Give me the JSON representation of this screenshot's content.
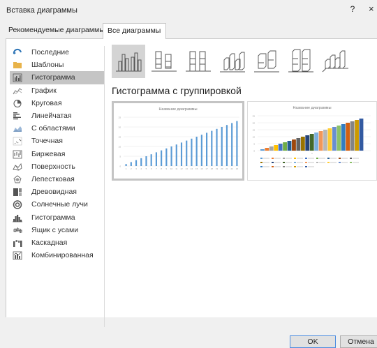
{
  "window": {
    "title": "Вставка диаграммы",
    "help": "?",
    "close": "×"
  },
  "tabs": [
    {
      "label": "Рекомендуемые диаграммы"
    },
    {
      "label": "Все диаграммы"
    }
  ],
  "sidebar": {
    "items": [
      {
        "label": "Последние",
        "icon": "recent-icon"
      },
      {
        "label": "Шаблоны",
        "icon": "folder-icon"
      },
      {
        "label": "Гистограмма",
        "icon": "column-chart-icon",
        "selected": true
      },
      {
        "label": "График",
        "icon": "line-chart-icon"
      },
      {
        "label": "Круговая",
        "icon": "pie-chart-icon"
      },
      {
        "label": "Линейчатая",
        "icon": "bar-chart-icon"
      },
      {
        "label": "С областями",
        "icon": "area-chart-icon"
      },
      {
        "label": "Точечная",
        "icon": "scatter-chart-icon"
      },
      {
        "label": "Биржевая",
        "icon": "stock-chart-icon"
      },
      {
        "label": "Поверхность",
        "icon": "surface-chart-icon"
      },
      {
        "label": "Лепестковая",
        "icon": "radar-chart-icon"
      },
      {
        "label": "Древовидная",
        "icon": "treemap-chart-icon"
      },
      {
        "label": "Солнечные лучи",
        "icon": "sunburst-chart-icon"
      },
      {
        "label": "Гистограмма",
        "icon": "histogram-chart-icon"
      },
      {
        "label": "Ящик с усами",
        "icon": "box-whisker-chart-icon"
      },
      {
        "label": "Каскадная",
        "icon": "waterfall-chart-icon"
      },
      {
        "label": "Комбинированная",
        "icon": "combo-chart-icon"
      }
    ]
  },
  "subtypes": [
    {
      "name": "clustered-column-subtype"
    },
    {
      "name": "stacked-column-subtype"
    },
    {
      "name": "100-stacked-column-subtype"
    },
    {
      "name": "3d-clustered-column-subtype"
    },
    {
      "name": "3d-stacked-column-subtype"
    },
    {
      "name": "3d-100-stacked-column-subtype"
    },
    {
      "name": "3d-column-subtype"
    }
  ],
  "section_title": "Гистограмма с группировкой",
  "previews": [
    {
      "title": "Название диаграммы",
      "chart_data": {
        "type": "bar",
        "categories": [
          "1",
          "2",
          "3",
          "4",
          "5",
          "6",
          "7",
          "8",
          "9",
          "10",
          "11",
          "12",
          "13",
          "14",
          "15",
          "16",
          "17",
          "18",
          "19",
          "20",
          "21",
          "22",
          "23"
        ],
        "values": [
          1,
          2,
          3,
          4,
          5,
          6,
          7,
          8,
          9,
          10,
          11,
          12,
          13,
          14,
          15,
          16,
          17,
          18,
          19,
          20,
          21,
          22,
          23
        ],
        "title": "Название диаграммы",
        "ylim": [
          0,
          25
        ],
        "grid": true,
        "color": "#5b9bd5"
      }
    },
    {
      "title": "Название диаграммы",
      "chart_data": {
        "type": "bar",
        "categories": [
          "1"
        ],
        "series": [
          {
            "values": [
              1
            ]
          },
          {
            "values": [
              2
            ]
          },
          {
            "values": [
              3
            ]
          },
          {
            "values": [
              4
            ]
          },
          {
            "values": [
              5
            ]
          },
          {
            "values": [
              6
            ]
          },
          {
            "values": [
              7
            ]
          },
          {
            "values": [
              8
            ]
          },
          {
            "values": [
              9
            ]
          },
          {
            "values": [
              10
            ]
          },
          {
            "values": [
              11
            ]
          },
          {
            "values": [
              12
            ]
          },
          {
            "values": [
              13
            ]
          },
          {
            "values": [
              14
            ]
          },
          {
            "values": [
              15
            ]
          },
          {
            "values": [
              16
            ]
          },
          {
            "values": [
              17
            ]
          },
          {
            "values": [
              18
            ]
          },
          {
            "values": [
              19
            ]
          },
          {
            "values": [
              20
            ]
          },
          {
            "values": [
              21
            ]
          },
          {
            "values": [
              22
            ]
          },
          {
            "values": [
              23
            ]
          }
        ],
        "title": "Название диаграммы",
        "ylim": [
          0,
          25
        ],
        "grid": true,
        "legend": "bottom",
        "colors": [
          "#5b9bd5",
          "#ed7d31",
          "#a5a5a5",
          "#ffc000",
          "#4472c4",
          "#70ad47",
          "#255e91",
          "#9e480e",
          "#636363",
          "#997300",
          "#264478",
          "#43682b",
          "#7cafdd",
          "#f1975a",
          "#b7b7b7",
          "#ffcd33",
          "#698ed0",
          "#8cc168",
          "#327dc2",
          "#d26012",
          "#848484",
          "#cc9a00",
          "#335aa1"
        ]
      }
    }
  ],
  "buttons": {
    "ok": "OK",
    "cancel": "Отмена"
  }
}
